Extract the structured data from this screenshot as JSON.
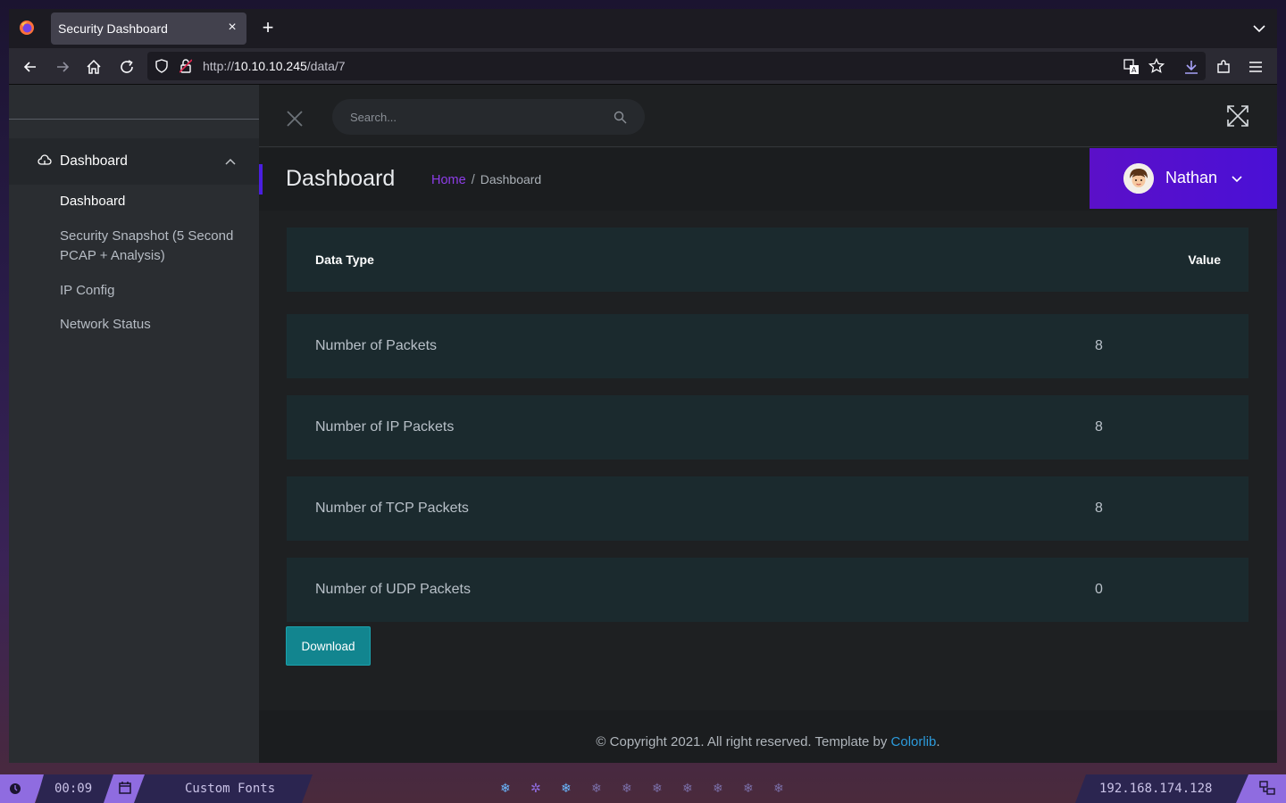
{
  "browser": {
    "tab_title": "Security Dashboard",
    "url_prefix": "http://",
    "url_host": "10.10.10.245",
    "url_path": "/data/7"
  },
  "sidebar": {
    "group_label": "Dashboard",
    "items": [
      {
        "label": "Dashboard",
        "active": true
      },
      {
        "label": "Security Snapshot (5 Second PCAP + Analysis)",
        "active": false
      },
      {
        "label": "IP Config",
        "active": false
      },
      {
        "label": "Network Status",
        "active": false
      }
    ]
  },
  "topbar": {
    "search_placeholder": "Search..."
  },
  "header": {
    "title": "Dashboard",
    "breadcrumb_home": "Home",
    "breadcrumb_sep": "/",
    "breadcrumb_current": "Dashboard"
  },
  "user": {
    "name": "Nathan"
  },
  "table": {
    "headers": [
      "Data Type",
      "Value"
    ],
    "rows": [
      {
        "type": "Number of Packets",
        "value": "8"
      },
      {
        "type": "Number of IP Packets",
        "value": "8"
      },
      {
        "type": "Number of TCP Packets",
        "value": "8"
      },
      {
        "type": "Number of UDP Packets",
        "value": "0"
      }
    ]
  },
  "download_label": "Download",
  "footer": {
    "text": "© Copyright 2021. All right reserved. Template by ",
    "link": "Colorlib",
    "end": "."
  },
  "taskbar": {
    "time": "00:09",
    "label": "Custom Fonts",
    "ip": "192.168.174.128"
  },
  "colors": {
    "accent_purple": "#4a10d6",
    "download_teal": "#12858f",
    "link_blue": "#2c9bdc"
  }
}
